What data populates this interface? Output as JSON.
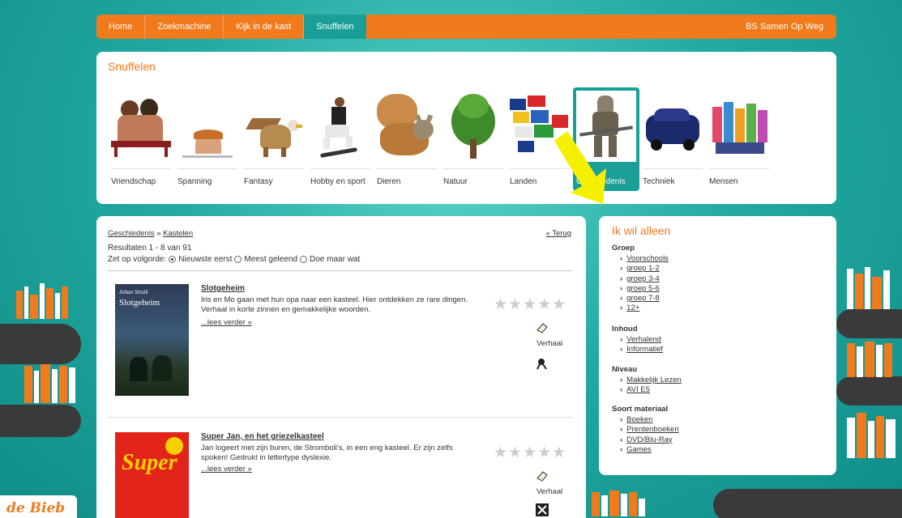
{
  "nav": {
    "items": [
      {
        "label": "Home"
      },
      {
        "label": "Zoekmachine"
      },
      {
        "label": "Kijk in de kast"
      },
      {
        "label": "Snuffelen"
      }
    ],
    "active": "Snuffelen",
    "school": "BS Samen Op Weg"
  },
  "snuffelen": {
    "title": "Snuffelen",
    "categories": [
      {
        "label": "Vriendschap"
      },
      {
        "label": "Spanning"
      },
      {
        "label": "Fantasy"
      },
      {
        "label": "Hobby en sport"
      },
      {
        "label": "Dieren"
      },
      {
        "label": "Natuur"
      },
      {
        "label": "Landen"
      },
      {
        "label": "Geschiedenis"
      },
      {
        "label": "Techniek"
      },
      {
        "label": "Mensen"
      }
    ],
    "active_category": "Geschiedenis"
  },
  "results": {
    "breadcrumb": [
      "Geschiedenis",
      "Kastelen"
    ],
    "breadcrumb_sep": "»",
    "back": "« Terug",
    "count": "Resultaten 1 - 8 van 91",
    "sort_label": "Zet op volgorde:",
    "sort_options": [
      "Nieuwste eerst",
      "Meest geleend",
      "Doe maar wat"
    ],
    "sort_selected": "Nieuwste eerst",
    "books": [
      {
        "title": "Slotgeheim",
        "description": "Iris en Mo gaan met hun opa naar een kasteel. Hier ontdekken ze rare dingen. Verhaal in korte zinnen en gemakkelijke woorden.",
        "read_more": "...lees verder »",
        "stars": "★★★★★",
        "type": "Verhaal",
        "cover_author": "Johan Struik",
        "cover_title": "Slotgeheim",
        "cover_color": "#2e3b55"
      },
      {
        "title": "Super Jan, en het griezelkasteel",
        "description": "Jan logeert met zijn buren, de Stromboli's, in een eng kasteel. Er zijn zelfs spoken! Gedrukt in lettertype dyslexie.",
        "read_more": "...lees verder »",
        "stars": "★★★★★",
        "type": "Verhaal",
        "cover_title": "Super",
        "cover_color": "#e2231a"
      }
    ]
  },
  "sidebar": {
    "title": "Ik wil alleen",
    "groups": [
      {
        "title": "Groep",
        "items": [
          "Voorschools",
          "groep 1-2",
          "groep 3-4",
          "groep 5-6",
          "groep 7-8",
          "12+"
        ]
      },
      {
        "title": "Inhoud",
        "items": [
          "Verhalend",
          "Informatief"
        ]
      },
      {
        "title": "Niveau",
        "items": [
          "Makkelijk Lezen",
          "AVI E5"
        ]
      },
      {
        "title": "Soort materiaal",
        "items": [
          "Boeken",
          "Prentenboeken",
          "DVD/Blu-Ray",
          "Games"
        ]
      }
    ]
  },
  "logo": {
    "text": "de Bieb"
  },
  "colors": {
    "accent": "#f07a1c",
    "teal": "#1a9e98",
    "arrow": "#f5f000"
  }
}
